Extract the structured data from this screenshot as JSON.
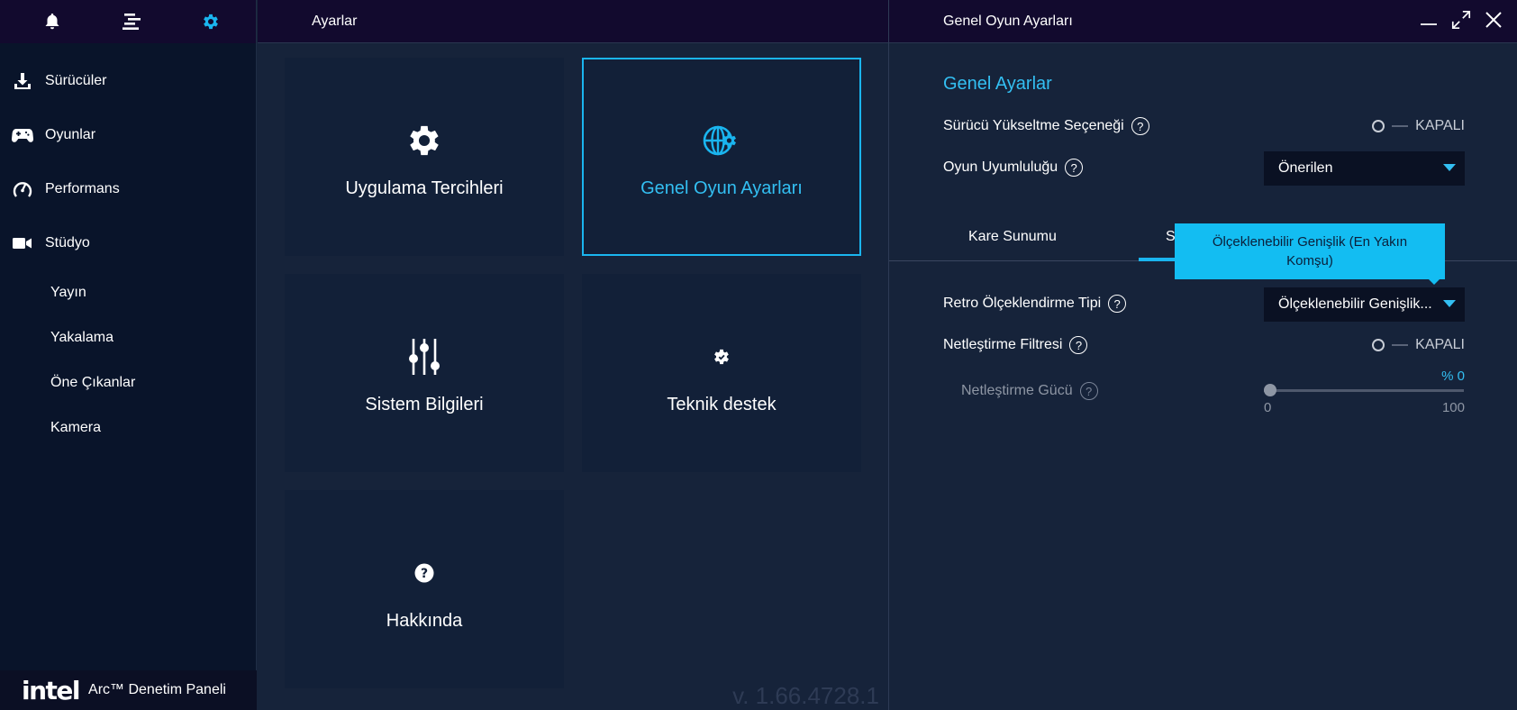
{
  "sidebar": {
    "top_icons": [
      "bell-icon",
      "menu-icon",
      "gear-icon"
    ],
    "nav": [
      {
        "label": "Sürücüler",
        "icon": "download-icon"
      },
      {
        "label": "Oyunlar",
        "icon": "gamepad-icon"
      },
      {
        "label": "Performans",
        "icon": "gauge-icon"
      },
      {
        "label": "Stüdyo",
        "icon": "video-camera-icon"
      }
    ],
    "sub_items": [
      "Yayın",
      "Yakalama",
      "Öne Çıkanlar",
      "Kamera"
    ],
    "brand": {
      "logo": "intel",
      "text": "Arc™ Denetim Paneli"
    }
  },
  "middle": {
    "title": "Ayarlar",
    "tiles": [
      {
        "label": "Uygulama Tercihleri",
        "icon": "gear-icon"
      },
      {
        "label": "Genel Oyun Ayarları",
        "icon": "globe-gear-icon",
        "active": true
      },
      {
        "label": "Sistem Bilgileri",
        "icon": "sliders-icon"
      },
      {
        "label": "Teknik destek",
        "icon": "gear-check-icon"
      },
      {
        "label": "Hakkında",
        "icon": "question-circle-icon"
      }
    ],
    "version": "v. 1.66.4728.1"
  },
  "panel": {
    "title": "Genel Oyun Ayarları",
    "section_title": "Genel Ayarlar",
    "driver_upgrade": {
      "label": "Sürücü Yükseltme Seçeneği",
      "state": "KAPALI"
    },
    "game_compat": {
      "label": "Oyun Uyumluluğu",
      "value": "Önerilen"
    },
    "tabs": [
      "Kare Sunumu",
      "S"
    ],
    "tooltip": "Ölçeklenebilir Genişlik (En Yakın Komşu)",
    "retro_scaling": {
      "label": "Retro Ölçeklendirme Tipi",
      "value": "Ölçeklenebilir Genişlik..."
    },
    "sharpen_filter": {
      "label": "Netleştirme Filtresi",
      "state": "KAPALI"
    },
    "sharpen_strength": {
      "label": "Netleştirme Gücü",
      "value_text": "% 0",
      "value": 0,
      "min": "0",
      "max": "100"
    },
    "help_glyph": "?",
    "accent_color": "#1ab5ef"
  }
}
